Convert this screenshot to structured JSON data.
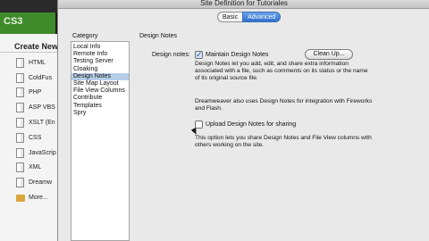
{
  "app": {
    "brand": "CS3"
  },
  "start_page": {
    "create_new_label": "Create New",
    "file_types": [
      {
        "label": "HTML",
        "icon": "document-icon"
      },
      {
        "label": "ColdFus",
        "icon": "document-icon"
      },
      {
        "label": "PHP",
        "icon": "document-icon"
      },
      {
        "label": "ASP VBS",
        "icon": "document-icon"
      },
      {
        "label": "XSLT (En",
        "icon": "document-icon"
      },
      {
        "label": "CSS",
        "icon": "document-icon"
      },
      {
        "label": "JavaScrip",
        "icon": "document-icon"
      },
      {
        "label": "XML",
        "icon": "document-icon"
      },
      {
        "label": "Dreamw",
        "icon": "document-icon"
      },
      {
        "label": "More...",
        "icon": "folder-icon"
      }
    ]
  },
  "dialog": {
    "title": "Site Definition for Tutoriales",
    "tabs": [
      {
        "label": "Basic",
        "selected": false
      },
      {
        "label": "Advanced",
        "selected": true
      }
    ],
    "category_label": "Category",
    "categories": [
      "Local Info",
      "Remote Info",
      "Testing Server",
      "Cloaking",
      "Design Notes",
      "Site Map Layout",
      "File View Columns",
      "Contribute",
      "Templates",
      "Spry"
    ],
    "selected_category": "Design Notes",
    "section_title": "Design Notes",
    "design_notes_label": "Design notes:",
    "maintain_checkbox": {
      "label": "Maintain Design Notes",
      "checked": true
    },
    "cleanup_button": "Clean Up...",
    "paragraph_1": "Design Notes let you add, edit, and share extra information associated with a file, such as comments on its status or the name of its original source file.",
    "paragraph_2": "Dreamweaver also uses Design Notes for integration with Fireworks and Flash.",
    "upload_checkbox": {
      "label": "Upload Design Notes for sharing",
      "checked": false
    },
    "paragraph_3": "This option lets you share Design Notes and File View columns with others working on the site."
  },
  "colors": {
    "brand_green": "#3f8a2b",
    "tab_selected": "#2f6fd0",
    "category_selected": "#b5cde8"
  }
}
